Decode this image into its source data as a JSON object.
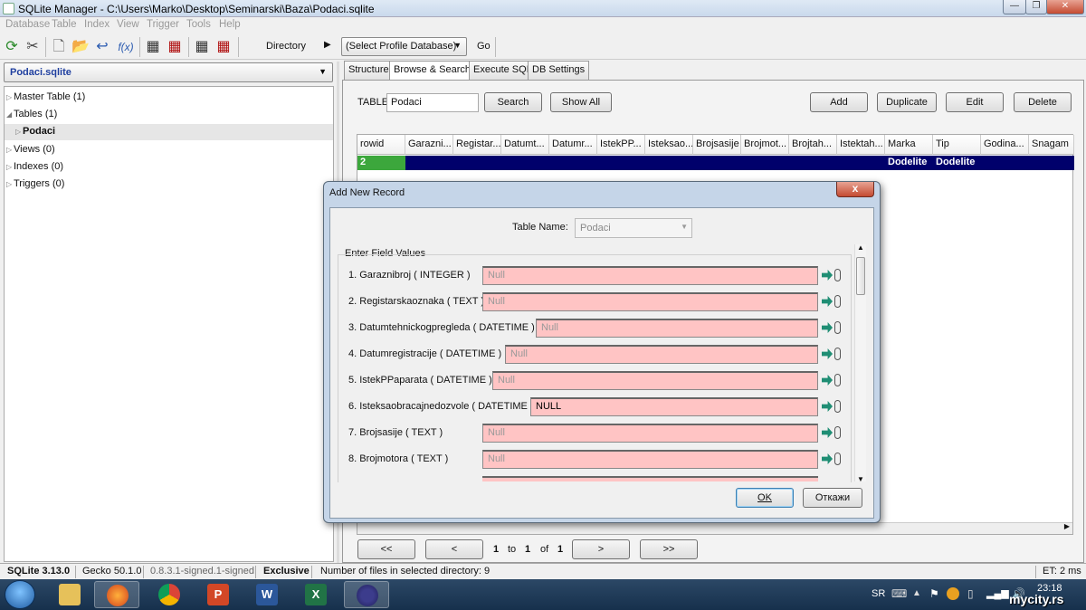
{
  "window": {
    "title": "SQLite Manager - C:\\Users\\Marko\\Desktop\\Seminarski\\Baza\\Podaci.sqlite",
    "minimize": "—",
    "maximize": "❐",
    "close": "✕"
  },
  "menu": [
    "Database",
    "Table",
    "Index",
    "View",
    "Trigger",
    "Tools",
    "Help"
  ],
  "toolbar": {
    "function_icon_text": "f(x)",
    "directory_label": "Directory",
    "profile_select": "(Select Profile Database)",
    "go_label": "Go"
  },
  "left": {
    "db_select": "Podaci.sqlite",
    "tree": [
      {
        "label": "Master Table (1)",
        "expanded": false
      },
      {
        "label": "Tables (1)",
        "expanded": true
      },
      {
        "label": "Podaci",
        "expanded": false,
        "selected": true
      },
      {
        "label": "Views (0)",
        "expanded": false
      },
      {
        "label": "Indexes (0)",
        "expanded": false
      },
      {
        "label": "Triggers (0)",
        "expanded": false
      }
    ]
  },
  "tabs": [
    "Structure",
    "Browse & Search",
    "Execute SQL",
    "DB Settings"
  ],
  "browse": {
    "table_label": "TABLE",
    "table_value": "Podaci",
    "search": "Search",
    "show_all": "Show All",
    "add": "Add",
    "duplicate": "Duplicate",
    "edit": "Edit",
    "delete": "Delete",
    "columns": [
      "rowid",
      "Garazni...",
      "Registar...",
      "Datumt...",
      "Datumr...",
      "IstekPP...",
      "Isteksao...",
      "Brojsasije",
      "Brojmot...",
      "Brojtah...",
      "Istektah...",
      "Marka",
      "Tip",
      "Godina...",
      "Snagam"
    ],
    "row": [
      "2",
      "",
      "",
      "",
      "",
      "",
      "",
      "",
      "",
      "",
      "",
      "Dodelite",
      "Dodelite",
      "",
      ""
    ],
    "pager": {
      "first": "<<",
      "prev": "<",
      "from": "1",
      "to_label": "to",
      "to": "1",
      "of_label": "of",
      "total": "1",
      "next": ">",
      "last": ">>"
    }
  },
  "dialog": {
    "title": "Add New Record",
    "close": "x",
    "table_name_label": "Table Name:",
    "table_name_value": "Podaci",
    "section_label": "Enter Field Values",
    "fields": [
      {
        "num": "1.",
        "label": "Garaznibroj ( INTEGER )",
        "value": "Null"
      },
      {
        "num": "2.",
        "label": "Registarskaoznaka ( TEXT )",
        "value": "Null"
      },
      {
        "num": "3.",
        "label": "Datumtehnickogpregleda ( DATETIME )",
        "value": "Null"
      },
      {
        "num": "4.",
        "label": "Datumregistracije ( DATETIME )",
        "value": "Null"
      },
      {
        "num": "5.",
        "label": "IstekPPaparata ( DATETIME )",
        "value": "Null"
      },
      {
        "num": "6.",
        "label": "Isteksaobracajnedozvole ( DATETIME )",
        "value": "NULL"
      },
      {
        "num": "7.",
        "label": "Brojsasije ( TEXT )",
        "value": "Null"
      },
      {
        "num": "8.",
        "label": "Brojmotora ( TEXT )",
        "value": "Null"
      }
    ],
    "ok": "OK",
    "cancel": "Откажи"
  },
  "status": {
    "sqlite": "SQLite 3.13.0",
    "gecko": "Gecko 50.1.0",
    "version": "0.8.3.1-signed.1-signed",
    "mode": "Exclusive",
    "files": "Number of files in selected directory: 9",
    "et": "ET: 2 ms"
  },
  "taskbar": {
    "start_icon": "windows-orb",
    "apps": [
      "file-explorer",
      "firefox",
      "chrome",
      "powerpoint",
      "word",
      "excel",
      "eclipse"
    ],
    "lang": "SR",
    "time": "23:18",
    "watermark": "mycity.rs"
  }
}
